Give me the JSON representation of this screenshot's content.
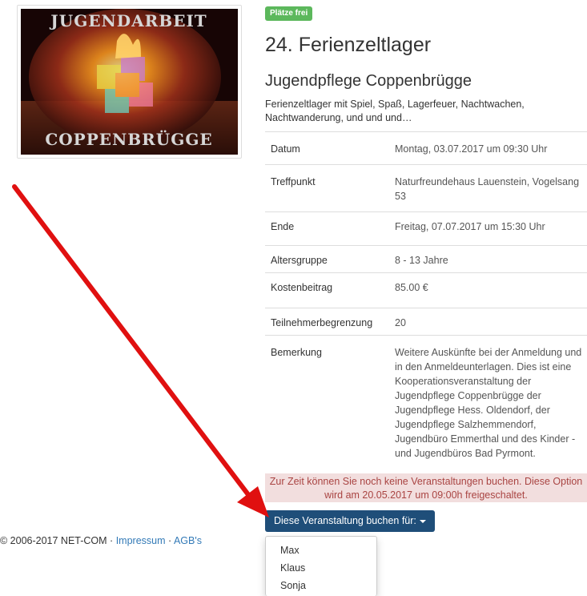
{
  "event": {
    "image_alt": "Jugendarbeit Coppenbrügge logo",
    "logo_text_top": "JUGENDARBEIT",
    "logo_text_bottom": "COPPENBRÜGGE",
    "status_badge": "Plätze frei",
    "title": "24. Ferienzeltlager",
    "organizer": "Jugendpflege Coppenbrügge",
    "description": "Ferienzeltlager mit Spiel, Spaß, Lagerfeuer, Nachtwachen, Nachtwanderung, und und und…"
  },
  "details": [
    {
      "key": "Datum",
      "value": "Montag, 03.07.2017 um 09:30 Uhr"
    },
    {
      "key": "Treffpunkt",
      "value": "Naturfreundehaus Lauenstein, Vogelsang 53"
    },
    {
      "key": "Ende",
      "value": "Freitag, 07.07.2017 um 15:30 Uhr"
    },
    {
      "key": "Altersgruppe",
      "value": "8 - 13 Jahre"
    },
    {
      "key": "Kostenbeitrag",
      "value": "85.00 €"
    },
    {
      "key": "Teilnehmerbegrenzung",
      "value": "20"
    },
    {
      "key": "Bemerkung",
      "value": "Weitere Auskünfte bei der Anmeldung und in den Anmeldeunterlagen. Dies ist eine Kooperationsveranstaltung der Jugendpflege Coppenbrügge der Jugendpflege Hess. Oldendorf, der Jugendpflege Salzhemmendorf, Jugendbüro Emmerthal und des Kinder - und Jugendbüros Bad Pyrmont."
    }
  ],
  "booking": {
    "notice_line1": "Zur Zeit können Sie noch keine Veranstaltungen buchen. Diese Option",
    "notice_line2": "wird am 20.05.2017 um 09:00h freigeschaltet.",
    "button_label": "Diese Veranstaltung buchen für:",
    "options": [
      "Max",
      "Klaus",
      "Sonja"
    ]
  },
  "footer": {
    "copyright": "© 2006-2017 NET-COM · ",
    "impressum": "Impressum",
    "separator": " · ",
    "agb": "AGB's"
  },
  "colors": {
    "badge": "#5cb85c",
    "button": "#1f4e79",
    "alert_bg": "#f2dede",
    "alert_text": "#a94442",
    "link": "#337ab7",
    "annotation_arrow": "#e01010"
  }
}
